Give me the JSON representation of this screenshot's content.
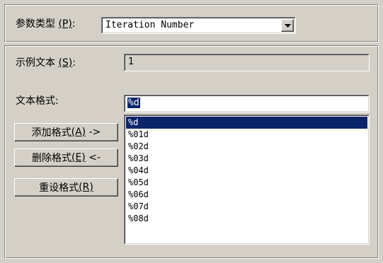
{
  "param_type": {
    "label_text": "参数类型 ",
    "label_key": "(P)",
    "label_suffix": ":",
    "value": "Iteration Number",
    "dropdown_icon": "chevron-down-icon"
  },
  "sample_text": {
    "label_text": "示例文本 ",
    "label_key": "(S)",
    "label_suffix": ":",
    "value": "1"
  },
  "text_format": {
    "label": "文本格式:",
    "value": "%d"
  },
  "buttons": {
    "add_text": "添加格式 ",
    "add_key": "(A)",
    "add_arrow": " ->",
    "delete_text": "删除格式 ",
    "delete_key": "(E)",
    "delete_arrow": " <-",
    "reset_text": "重设格式 ",
    "reset_key": "(R)"
  },
  "format_list": {
    "items": [
      "%d",
      "%01d",
      "%02d",
      "%03d",
      "%04d",
      "%05d",
      "%06d",
      "%07d",
      "%08d"
    ],
    "selected": "%d"
  },
  "colors": {
    "background": "#d4d0c8",
    "selection": "#0a246a"
  }
}
